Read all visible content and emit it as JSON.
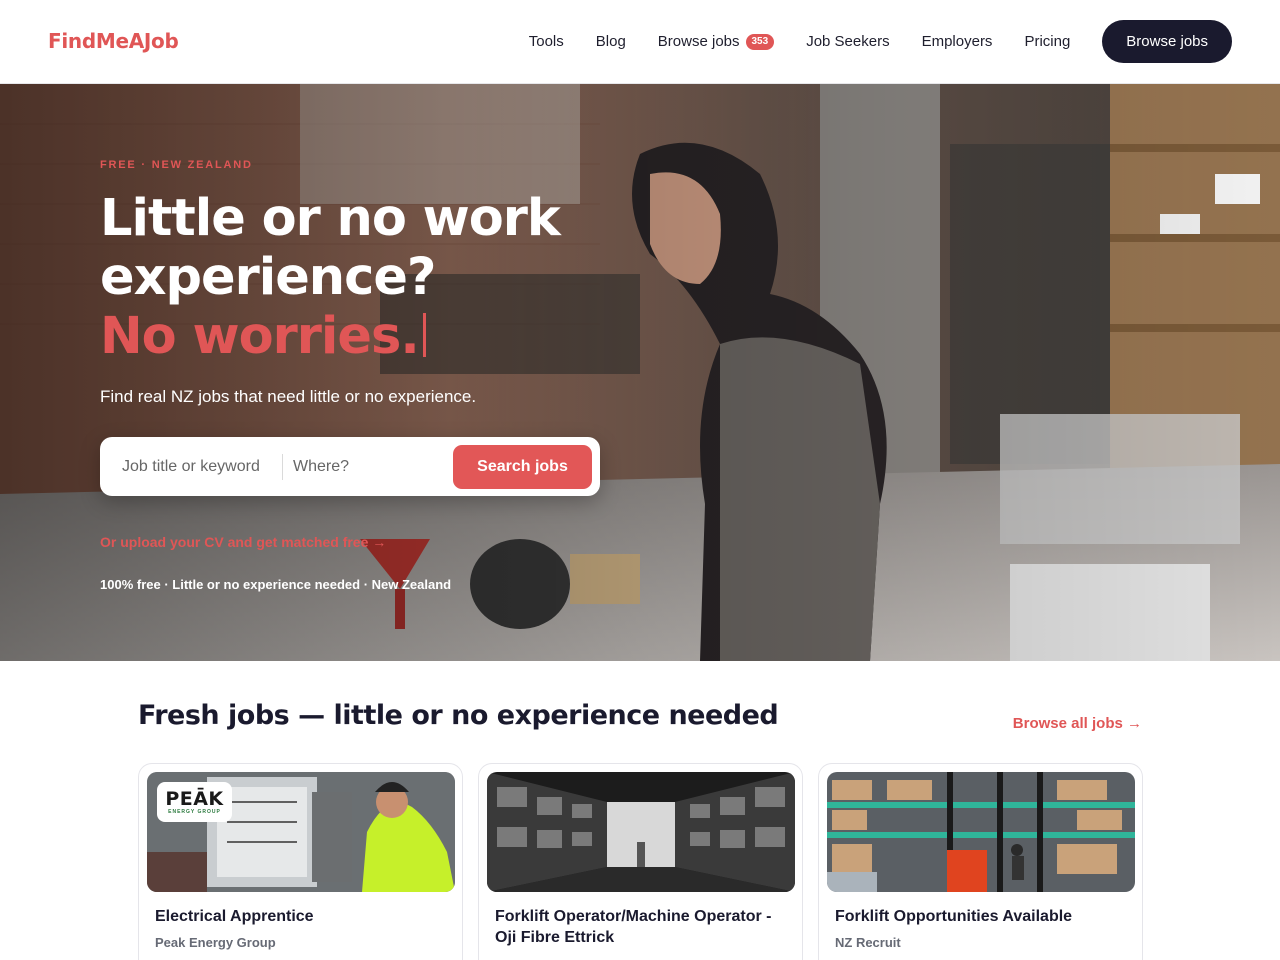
{
  "header": {
    "logo": "FindMeAJob",
    "nav": [
      {
        "label": "Tools"
      },
      {
        "label": "Blog"
      },
      {
        "label": "Browse jobs",
        "badge": "353"
      },
      {
        "label": "Job Seekers"
      },
      {
        "label": "Employers"
      },
      {
        "label": "Pricing"
      }
    ],
    "cta": "Browse jobs"
  },
  "hero": {
    "eyebrow": "FREE · NEW ZEALAND",
    "headline_line1": "Little or no work",
    "headline_line2": "experience?",
    "headline_accent": "No worries.",
    "subline": "Find real NZ jobs that need little or no experience.",
    "search": {
      "keyword_placeholder": "Job title or keyword",
      "keyword_value": "",
      "where_placeholder": "Where?",
      "where_value": "",
      "button": "Search jobs"
    },
    "upload_link": "Or upload your CV and get matched free →",
    "trust": "100% free · Little or no experience needed · New Zealand"
  },
  "jobs": {
    "title": "Fresh jobs — little or no experience needed",
    "browse_all": "Browse all jobs →",
    "cards": [
      {
        "title": "Electrical Apprentice",
        "company": "Peak Energy Group",
        "logo_text": "PEĀK",
        "logo_sub": "ENERGY GROUP"
      },
      {
        "title": "Forklift Operator/Machine Operator - Oji Fibre Ettrick",
        "company": ""
      },
      {
        "title": "Forklift Opportunities Available",
        "company": "NZ Recruit"
      }
    ]
  },
  "colors": {
    "accent": "#e05656",
    "dark": "#1a1a2e",
    "text_muted": "#666a75"
  }
}
